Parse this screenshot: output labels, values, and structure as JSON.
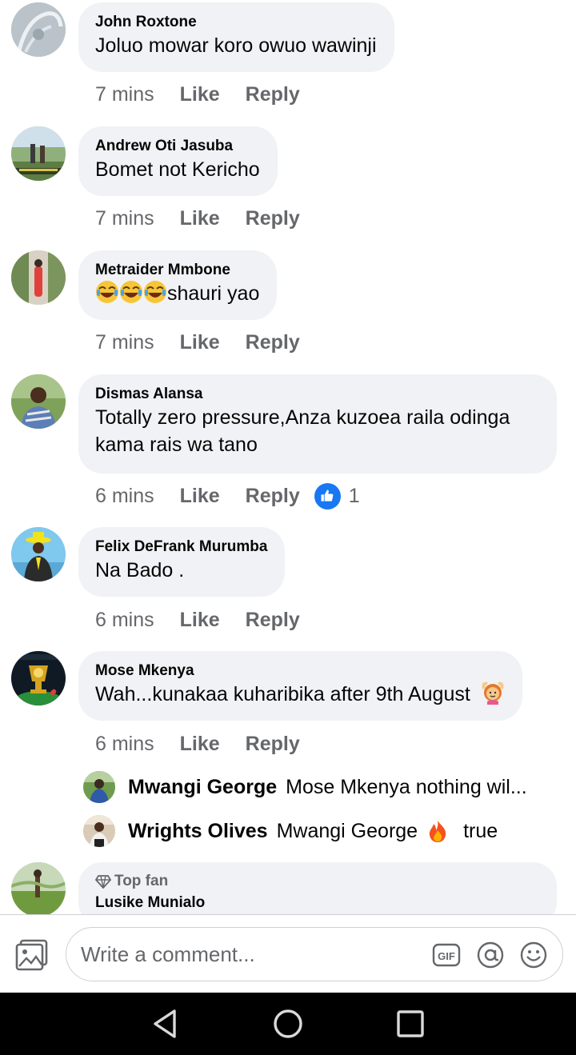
{
  "comments": [
    {
      "author": "John Roxtone",
      "text": "Joluo mowar koro owuo wawinji",
      "time": "7 mins",
      "like": "Like",
      "reply": "Reply"
    },
    {
      "author": "Andrew Oti Jasuba",
      "text": "Bomet not Kericho",
      "time": "7 mins",
      "like": "Like",
      "reply": "Reply"
    },
    {
      "author": "Metraider Mmbone",
      "emoji": "face-with-tears-of-joy",
      "text": "shauri yao",
      "time": "7 mins",
      "like": "Like",
      "reply": "Reply"
    },
    {
      "author": "Dismas Alansa",
      "text": "Totally zero pressure,Anza kuzoea raila odinga kama rais wa tano",
      "time": "6 mins",
      "like": "Like",
      "reply": "Reply",
      "reaction_count": "1",
      "reaction_icon": "thumbs-up-icon"
    },
    {
      "author": "Felix DeFrank Murumba",
      "text": "Na Bado .",
      "time": "6 mins",
      "like": "Like",
      "reply": "Reply"
    },
    {
      "author": "Mose Mkenya",
      "text": "Wah...kunakaa kuharibika after 9th August",
      "emoji": "person-gesturing-ok",
      "time": "6 mins",
      "like": "Like",
      "reply": "Reply"
    }
  ],
  "replies": [
    {
      "author": "Mwangi George",
      "text": "Mose Mkenya nothing wil..."
    },
    {
      "author": "Wrights Olives",
      "text_before": "Mwangi George",
      "emoji": "fire",
      "text_after": "true"
    }
  ],
  "partial_comment": {
    "badge": "Top fan",
    "author": "Lusike Munialo"
  },
  "composer": {
    "placeholder": "Write a comment...",
    "gif_label": "GIF"
  },
  "icons": {
    "photo": "photo-icon",
    "gif": "gif-icon",
    "mention": "at-mention-icon",
    "emoji": "smiley-icon",
    "back": "back-nav-icon",
    "home": "home-nav-icon",
    "recents": "recents-nav-icon"
  },
  "colors": {
    "bubble": "#f0f2f5",
    "meta": "#65676b",
    "like_blue": "#1877f2",
    "navbar": "#000000"
  }
}
